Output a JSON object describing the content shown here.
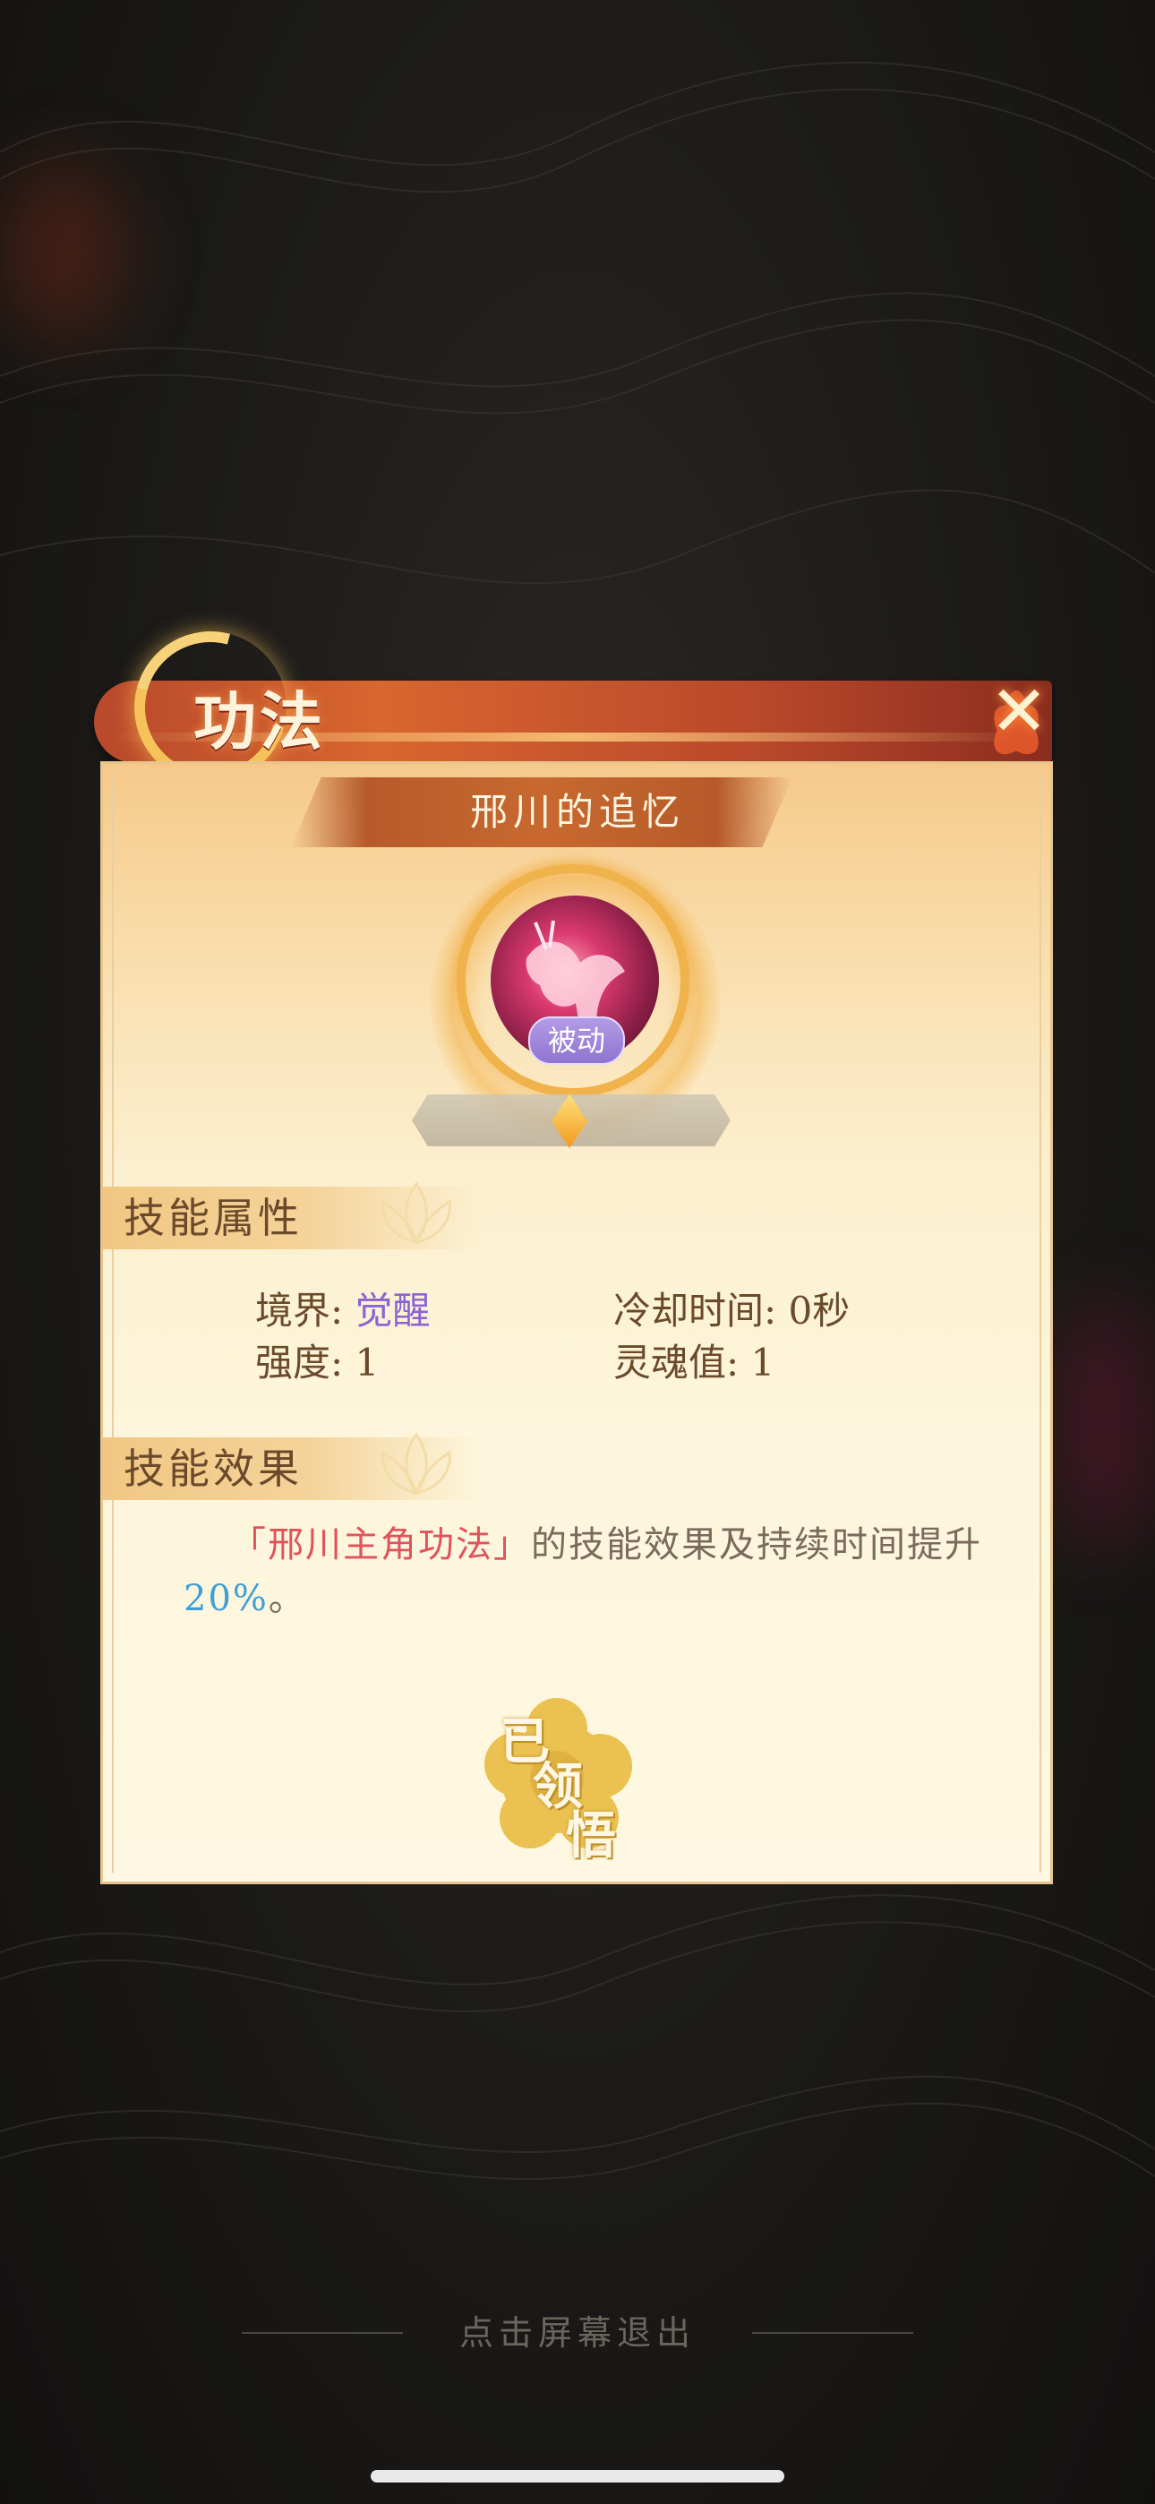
{
  "panel": {
    "header_title": "功法",
    "skill_name": "邢川的追忆",
    "skill_type_badge": "被动"
  },
  "attributes": {
    "section_title": "技能属性",
    "realm_label": "境界: ",
    "realm_value": "觉醒",
    "cooldown": "冷却时间: 0秒",
    "strength": "强度: 1",
    "soul_value": "灵魂值: 1"
  },
  "effect": {
    "section_title": "技能效果",
    "highlight": "「邢川主角功法」",
    "text_middle": "的技能效果及持续时间提升",
    "percent": "20%",
    "text_end": "。"
  },
  "stamp": {
    "char1": "已",
    "char2": "领",
    "char3": "悟"
  },
  "footer": {
    "exit_hint": "点击屏幕退出"
  },
  "colors": {
    "accent_red": "#e0535b",
    "accent_blue": "#3e9fd6",
    "accent_purple": "#8c63d1",
    "header_orange": "#d8662f"
  },
  "icons": [
    "close-icon",
    "moon-icon",
    "lotus-icon",
    "level-gem-icon",
    "skill-icon"
  ]
}
